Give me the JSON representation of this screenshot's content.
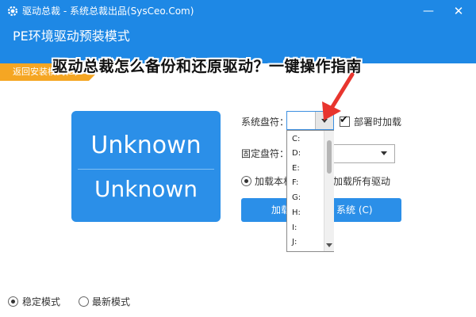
{
  "window": {
    "title": "驱动总裁 - 系统总裁出品(SysCeo.Com)",
    "minimize_glyph": "—",
    "close_glyph": "✕",
    "icon": "gear-icon"
  },
  "header": {
    "subtitle": "PE环境驱动预装模式"
  },
  "back_tab": {
    "label": "返回安装模式(B)"
  },
  "overlay": {
    "headline": "驱动总裁怎么备份和还原驱动？一键操作指南"
  },
  "system_card": {
    "line1": "Unknown",
    "line2": "Unknown"
  },
  "form": {
    "system_drive_label": "系统盘符：",
    "system_drive_value": "",
    "deploy_load_label": "部署时加载",
    "deploy_load_checked": true,
    "fixed_drive_label": "固定盘符：",
    "fixed_drive_value": "",
    "load_local_label": "加载本机",
    "load_all_label": "加载所有驱动",
    "selected_load": "load_local",
    "action_left": "加载",
    "action_right": "系统 (C)"
  },
  "drive_list": {
    "items": [
      "C:",
      "D:",
      "E:",
      "F:",
      "G:",
      "H:",
      "I:",
      "J:"
    ]
  },
  "mode": {
    "stable_label": "稳定模式",
    "latest_label": "最新模式",
    "selected": "stable"
  },
  "colors": {
    "primary": "#1e88e5",
    "card": "#2b8fe8",
    "back_tab": "#f5a623",
    "annotation": "#e8352e"
  }
}
